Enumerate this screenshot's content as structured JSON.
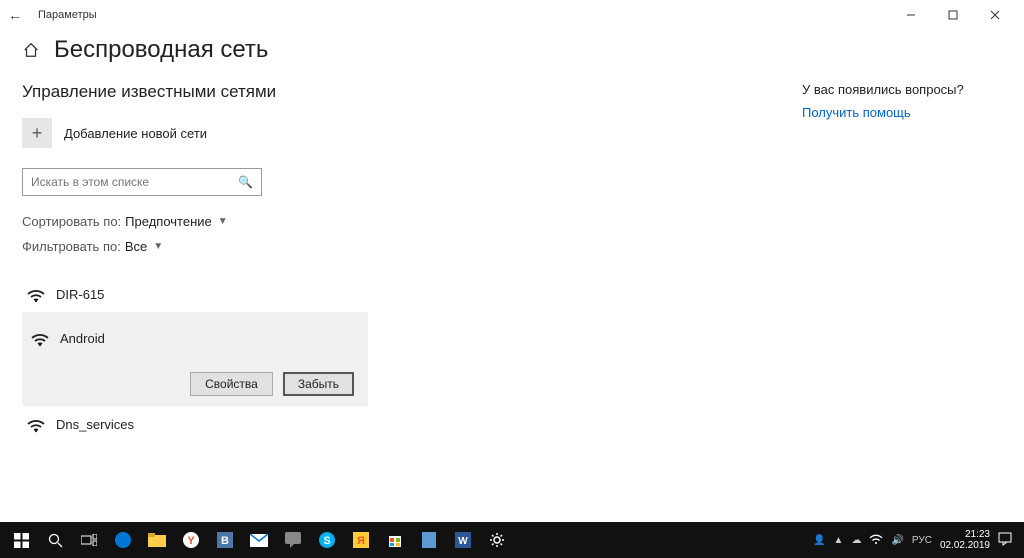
{
  "window": {
    "title": "Параметры"
  },
  "page": {
    "title": "Беспроводная сеть"
  },
  "section": {
    "subtitle": "Управление известными сетями",
    "add_label": "Добавление новой сети"
  },
  "search": {
    "placeholder": "Искать в этом списке"
  },
  "sort": {
    "label": "Сортировать по:",
    "value": "Предпочтение"
  },
  "filter": {
    "label": "Фильтровать по:",
    "value": "Все"
  },
  "networks": [
    {
      "name": "DIR-615"
    },
    {
      "name": "Android"
    },
    {
      "name": "Dns_services"
    }
  ],
  "actions": {
    "properties": "Свойства",
    "forget": "Забыть"
  },
  "help": {
    "question": "У вас появились вопросы?",
    "link": "Получить помощь"
  },
  "tray": {
    "lang": "РУС",
    "time": "21:23",
    "date": "02.02.2019"
  }
}
